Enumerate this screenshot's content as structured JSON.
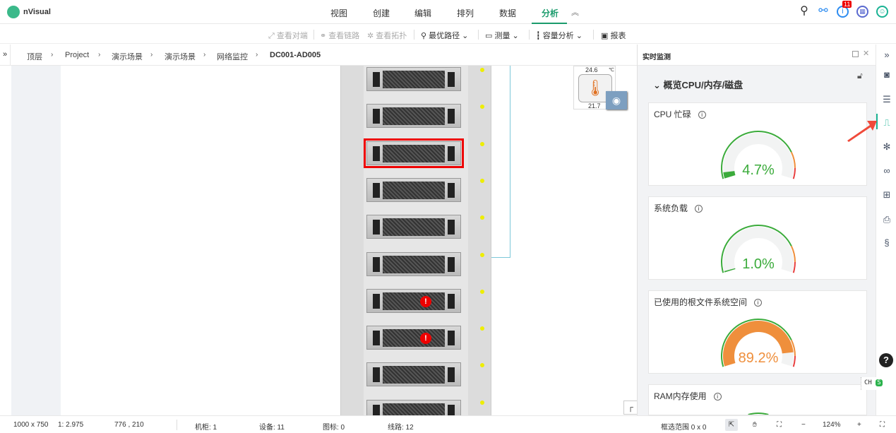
{
  "app": {
    "name": "nVisual"
  },
  "menu": [
    {
      "label": "视图"
    },
    {
      "label": "创建"
    },
    {
      "label": "编辑"
    },
    {
      "label": "排列"
    },
    {
      "label": "数据"
    },
    {
      "label": "分析",
      "active": true
    }
  ],
  "header_icons": {
    "notification_count": "11"
  },
  "toolbar": {
    "view_peer": "查看对端",
    "view_link": "查看链路",
    "view_topology": "查看拓扑",
    "optimal_path": "最优路径",
    "measure": "测量",
    "capacity": "容量分析",
    "report": "报表"
  },
  "breadcrumb": [
    "顶层",
    "Project",
    "演示场景",
    "演示场景",
    "网络监控",
    "DC001-AD005"
  ],
  "sensor": {
    "temp_top": "24.6",
    "unit": "℃",
    "temp_bottom": "21.7"
  },
  "rack": {
    "servers": [
      {
        "alarm": false
      },
      {
        "alarm": false
      },
      {
        "alarm": false,
        "selected": true
      },
      {
        "alarm": false
      },
      {
        "alarm": false
      },
      {
        "alarm": false
      },
      {
        "alarm": true,
        "alarm_text": "!"
      },
      {
        "alarm": true,
        "alarm_text": "!"
      },
      {
        "alarm": false
      },
      {
        "alarm": false
      }
    ]
  },
  "panel": {
    "title": "实时监测",
    "section": "概览CPU/内存/磁盘",
    "gauges": [
      {
        "title": "CPU 忙碌",
        "value": 4.7,
        "label": "4.7%",
        "color": "#3bab3b"
      },
      {
        "title": "系统负载",
        "value": 1.0,
        "label": "1.0%",
        "color": "#3bab3b"
      },
      {
        "title": "已使用的根文件系统空间",
        "value": 89.2,
        "label": "89.2%",
        "color": "#ef8f3c"
      },
      {
        "title": "RAM内存使用",
        "value": 6,
        "label": "",
        "color": "#3bab3b"
      }
    ]
  },
  "ime": {
    "label": "CH"
  },
  "status": {
    "size": "1000 x 750",
    "scale": "1: 2.975",
    "coords": "776 , 210",
    "cabinets": "机柜: 1",
    "devices": "设备: 11",
    "icons": "图标: 0",
    "lines": "线路: 12",
    "selection": "框选范围  0 x 0",
    "zoom": "124%"
  }
}
